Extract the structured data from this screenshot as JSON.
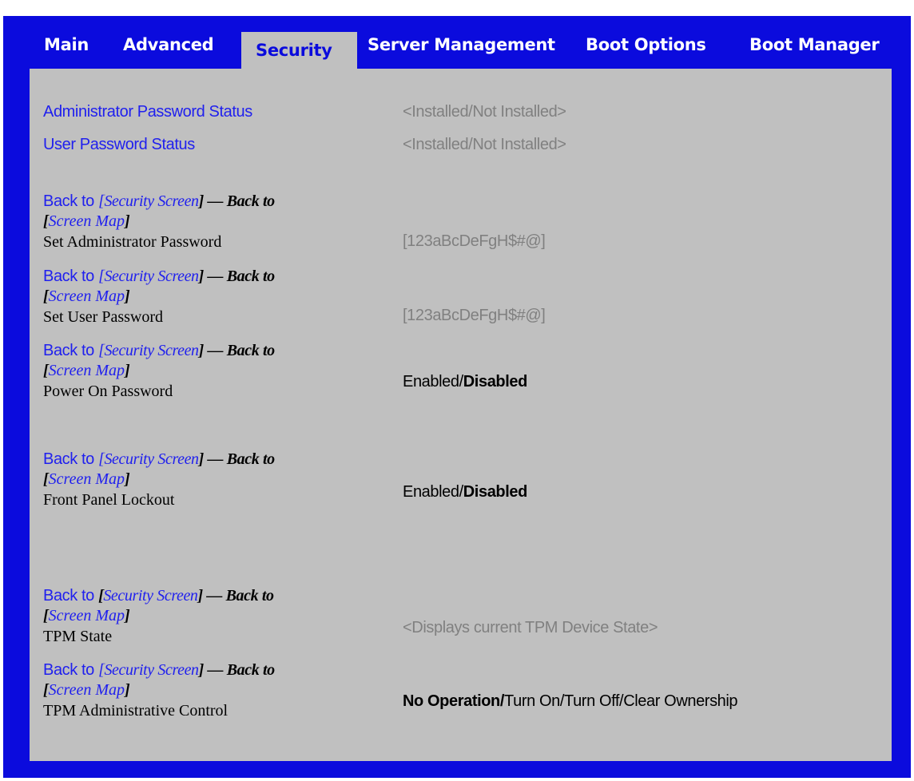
{
  "tabs": [
    {
      "label": "Main",
      "active": false
    },
    {
      "label": "Advanced",
      "active": false
    },
    {
      "label": "Security",
      "active": true
    },
    {
      "label": "Server Management",
      "active": false
    },
    {
      "label": "Boot Options",
      "active": false
    },
    {
      "label": "Boot Manager",
      "active": false
    }
  ],
  "status": {
    "admin_label": "Administrator Password Status",
    "admin_value": "<Installed/Not Installed>",
    "user_label": "User Password Status",
    "user_value": "<Installed/Not Installed>"
  },
  "nav": {
    "back_to": "Back to ",
    "bracket_open": "[",
    "security_screen": "Security Screen",
    "bracket_close": "]",
    "dash_back_to": " — Back to",
    "screen_map": "Screen Map"
  },
  "items": [
    {
      "name": "Set Administrator Password",
      "value": "[123aBcDeFgH$#@]"
    },
    {
      "name": "Set User Password",
      "value": "[123aBcDeFgH$#@]"
    },
    {
      "name": "Power On Password",
      "value_normal": "Enabled/",
      "value_bold": "Disabled"
    },
    {
      "name": "Front Panel Lockout",
      "value_normal": "Enabled/",
      "value_bold": "Disabled"
    },
    {
      "name": "TPM State",
      "value": "<Displays current TPM Device State>"
    },
    {
      "name": "TPM Administrative Control",
      "value_bold": "No Operation/",
      "value_normal": "Turn On/Turn Off/Clear Ownership"
    }
  ],
  "colors": {
    "frame": "#0b0bdd",
    "panel": "#c0c0c0",
    "link": "#2020ee",
    "value_gray": "#808080"
  }
}
